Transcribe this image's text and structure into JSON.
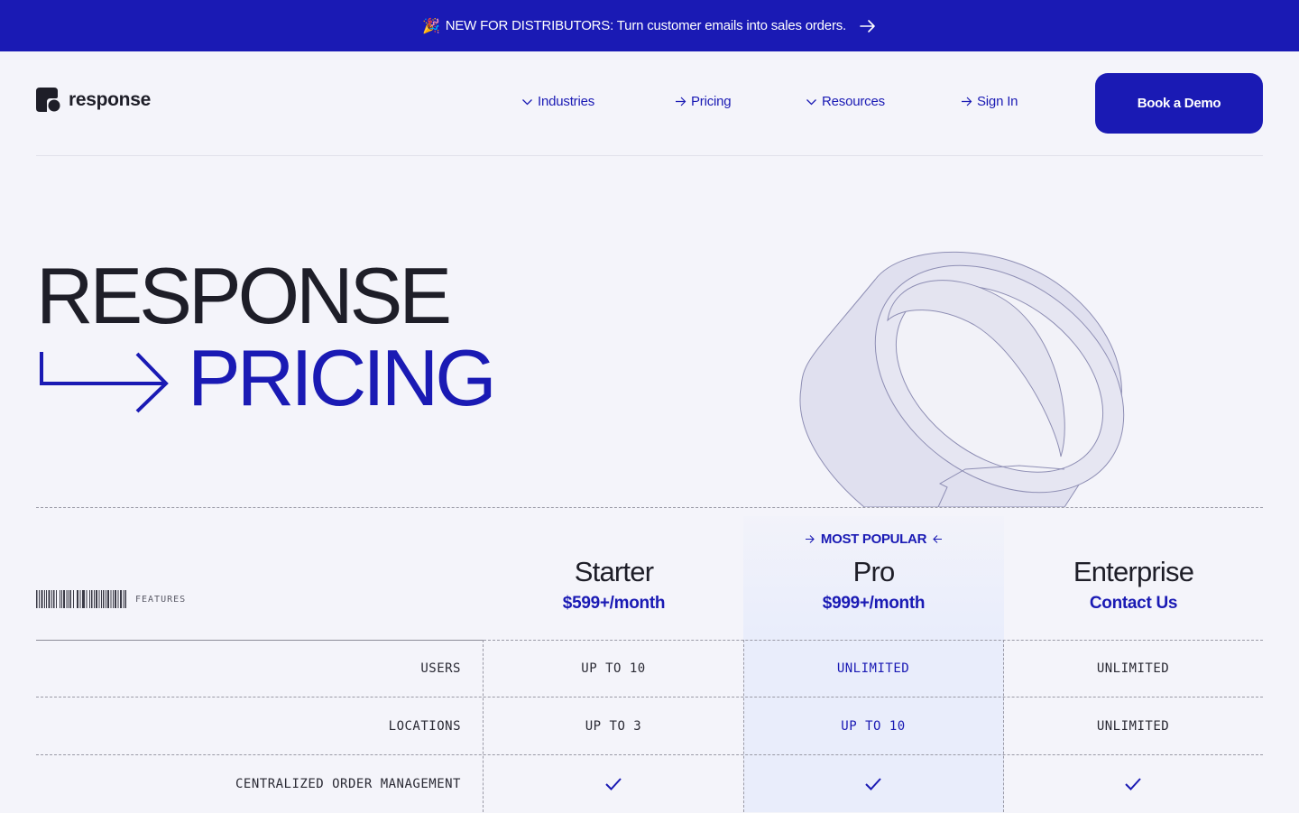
{
  "announcement": {
    "icon": "party-popper-icon",
    "text": "NEW FOR DISTRIBUTORS: Turn customer emails into sales orders."
  },
  "header": {
    "logo_text": "response",
    "nav": [
      {
        "label": "Industries",
        "icon": "chevron-down-icon"
      },
      {
        "label": "Pricing",
        "icon": "arrow-right-icon"
      },
      {
        "label": "Resources",
        "icon": "chevron-down-icon"
      },
      {
        "label": "Sign In",
        "icon": "arrow-right-icon"
      }
    ],
    "cta": "Book a Demo"
  },
  "hero": {
    "line1": "RESPONSE",
    "line2": "PRICING"
  },
  "pricing": {
    "features_label": "FEATURES",
    "popular_label": "MOST POPULAR",
    "plans": [
      {
        "name": "Starter",
        "price": "$599+/month"
      },
      {
        "name": "Pro",
        "price": "$999+/month"
      },
      {
        "name": "Enterprise",
        "price": "Contact Us"
      }
    ],
    "rows": [
      {
        "feature": "USERS",
        "values": [
          "UP TO 10",
          "UNLIMITED",
          "UNLIMITED"
        ]
      },
      {
        "feature": "LOCATIONS",
        "values": [
          "UP TO 3",
          "UP TO 10",
          "UNLIMITED"
        ]
      },
      {
        "feature": "CENTRALIZED ORDER MANAGEMENT",
        "values": [
          "check",
          "check",
          "check"
        ]
      }
    ]
  },
  "colors": {
    "brand_blue": "#1a1ab4",
    "background": "#f4f4fa",
    "pro_highlight": "#e9edfb",
    "text_dark": "#1e1e28"
  }
}
